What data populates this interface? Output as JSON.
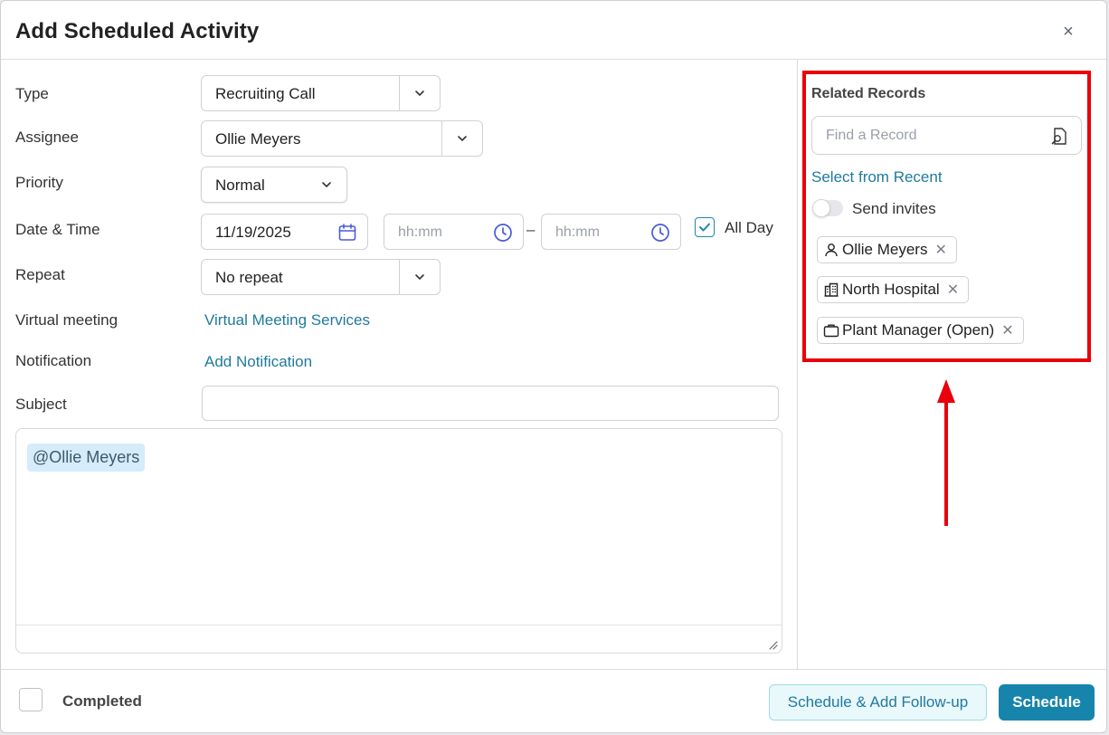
{
  "dialog": {
    "title": "Add Scheduled Activity",
    "close_glyph": "×"
  },
  "form": {
    "type": {
      "label": "Type",
      "value": "Recruiting Call"
    },
    "assignee": {
      "label": "Assignee",
      "value": "Ollie Meyers"
    },
    "priority": {
      "label": "Priority",
      "value": "Normal"
    },
    "datetime": {
      "label": "Date & Time",
      "date": "11/19/2025",
      "start_placeholder": "hh:mm",
      "end_placeholder": "hh:mm",
      "separator": "–",
      "all_day_label": "All Day",
      "all_day_checked": true
    },
    "repeat": {
      "label": "Repeat",
      "value": "No repeat"
    },
    "virtual_meeting": {
      "label": "Virtual meeting",
      "link": "Virtual Meeting Services"
    },
    "notification": {
      "label": "Notification",
      "link": "Add Notification"
    },
    "subject": {
      "label": "Subject",
      "value": ""
    },
    "notes": {
      "mention": "@Ollie Meyers"
    }
  },
  "related_records": {
    "title": "Related Records",
    "search_placeholder": "Find a Record",
    "recent_link": "Select from Recent",
    "send_invites_label": "Send invites",
    "send_invites_on": false,
    "records": [
      {
        "icon": "person-icon",
        "label": "Ollie Meyers",
        "remove": "✕"
      },
      {
        "icon": "building-icon",
        "label": "North Hospital",
        "remove": "✕"
      },
      {
        "icon": "briefcase-icon",
        "label": "Plant Manager (Open)",
        "remove": "✕"
      }
    ]
  },
  "footer": {
    "completed_label": "Completed",
    "followup_button": "Schedule & Add Follow-up",
    "schedule_button": "Schedule"
  },
  "colors": {
    "accent": "#1785ab",
    "link": "#1f7a9e",
    "highlight": "#e8000b",
    "icon_blue": "#4a5bd6"
  }
}
